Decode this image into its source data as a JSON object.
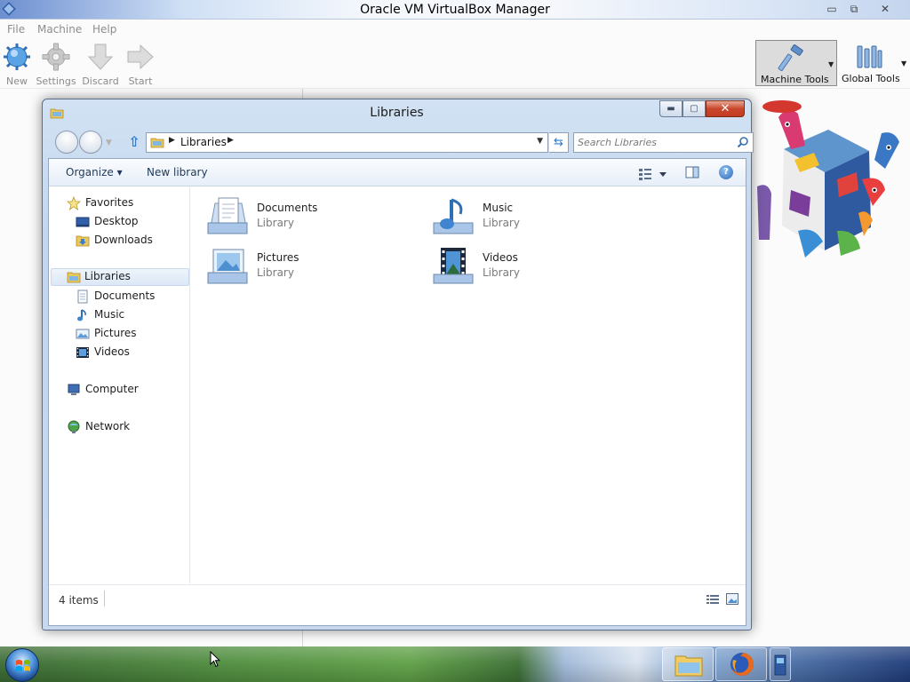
{
  "vbox": {
    "title": "Oracle VM VirtualBox Manager",
    "menu": [
      "File",
      "Machine",
      "Help"
    ],
    "toolbar": {
      "new": "New",
      "settings": "Settings",
      "discard": "Discard",
      "start": "Start"
    },
    "tools": {
      "machine": "Machine Tools",
      "global": "Global Tools"
    },
    "window_controls": {
      "minimize": "▭",
      "restore": "⧉",
      "close": "✕"
    }
  },
  "explorer": {
    "title": "Libraries",
    "window_controls": {
      "minimize": "▬",
      "maximize": "▢",
      "close": "✕"
    },
    "address": {
      "label": "Libraries",
      "separator": "▶",
      "dropdown": "▼"
    },
    "search": {
      "placeholder": "Search Libraries"
    },
    "commands": {
      "organize": "Organize ▾",
      "new_library": "New library",
      "help": "?"
    },
    "nav": {
      "favorites": "Favorites",
      "desktop": "Desktop",
      "downloads": "Downloads",
      "libraries": "Libraries",
      "documents": "Documents",
      "music": "Music",
      "pictures": "Pictures",
      "videos": "Videos",
      "computer": "Computer",
      "network": "Network"
    },
    "libraries": [
      {
        "name": "Documents",
        "type": "Library",
        "icon": "documents-library-icon"
      },
      {
        "name": "Music",
        "type": "Library",
        "icon": "music-library-icon"
      },
      {
        "name": "Pictures",
        "type": "Library",
        "icon": "pictures-library-icon"
      },
      {
        "name": "Videos",
        "type": "Library",
        "icon": "videos-library-icon"
      }
    ],
    "status": {
      "count": "4 items"
    }
  },
  "taskbar": {
    "items": [
      "windows-explorer-icon",
      "firefox-icon",
      "virtualbox-icon"
    ]
  },
  "colors": {
    "accent": "#2a78c8",
    "explorer_frame": "#c3d6ee",
    "close_red": "#c9462c"
  }
}
